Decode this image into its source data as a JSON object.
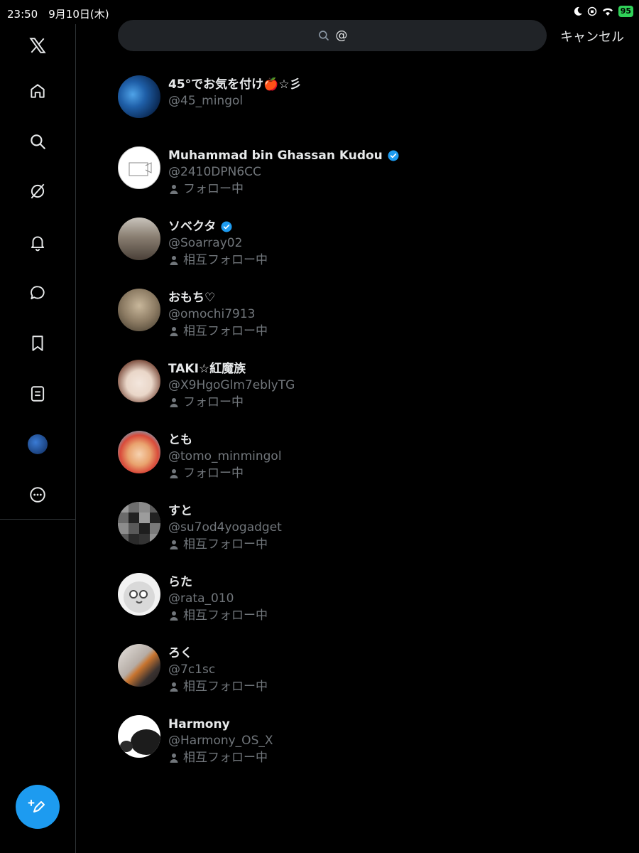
{
  "status_bar": {
    "time_date": "23:50　9月10日(木)",
    "battery": "95"
  },
  "search": {
    "query": "@"
  },
  "cancel_label": "キャンセル",
  "colors": {
    "accent": "#1d9bf0",
    "background": "#000000",
    "secondary_text": "#71767b",
    "battery": "#30d158"
  },
  "sidebar": {
    "items": [
      {
        "name": "x-logo-icon"
      },
      {
        "name": "home-icon"
      },
      {
        "name": "search-icon"
      },
      {
        "name": "grok-icon"
      },
      {
        "name": "notifications-icon"
      },
      {
        "name": "messages-icon"
      },
      {
        "name": "bookmarks-icon"
      },
      {
        "name": "lists-icon"
      },
      {
        "name": "profile-avatar"
      },
      {
        "name": "more-icon"
      }
    ],
    "compose": {
      "icon": "compose-icon"
    }
  },
  "results": [
    {
      "name": "45°でお気を付け🍎☆彡",
      "handle": "@45_mingol",
      "verified": false,
      "follow": ""
    },
    {
      "name": "Muhammad bin Ghassan Kudou",
      "handle": "@2410DPN6CC",
      "verified": true,
      "follow": "フォロー中"
    },
    {
      "name": "ソベクタ",
      "handle": "@Soarray02",
      "verified": true,
      "follow": "相互フォロー中"
    },
    {
      "name": "おもち♡",
      "handle": "@omochi7913",
      "verified": false,
      "follow": "相互フォロー中"
    },
    {
      "name": "TAKI☆紅魔族",
      "handle": "@X9HgoGlm7eblyTG",
      "verified": false,
      "follow": "フォロー中"
    },
    {
      "name": "とも",
      "handle": "@tomo_minmingol",
      "verified": false,
      "follow": "フォロー中"
    },
    {
      "name": "すと",
      "handle": "@su7od4yogadget",
      "verified": false,
      "follow": "相互フォロー中"
    },
    {
      "name": "らた",
      "handle": "@rata_010",
      "verified": false,
      "follow": "相互フォロー中"
    },
    {
      "name": "ろく",
      "handle": "@7c1sc",
      "verified": false,
      "follow": "相互フォロー中"
    },
    {
      "name": "Harmony",
      "handle": "@Harmony_OS_X",
      "verified": false,
      "follow": "相互フォロー中"
    }
  ]
}
